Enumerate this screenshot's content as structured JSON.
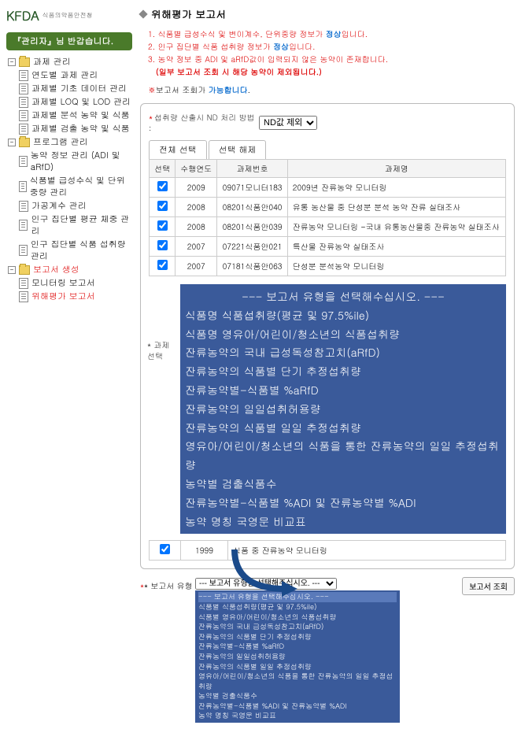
{
  "logo": {
    "main": "KFDA",
    "sub": "식품의약품안전청"
  },
  "welcome": "『관리자』님 반갑습니다.",
  "tree": {
    "group1": "과제 관리",
    "g1_items": [
      "연도별 과제 관리",
      "과제별 기초 데이터 관리",
      "과제별 LOQ 및 LOD 관리",
      "과제별 분석 농약 및 식품",
      "과제별 검출 농약 및 식품"
    ],
    "group2": "프로그램 관리",
    "g2_items": [
      "농약 정보 관리 (ADI 및 aRfD)",
      "식품별 급성수식 및 단위중량 관리",
      "가공계수 관리",
      "인구 집단별 평균 체중 관리",
      "인구 집단별 식품 섭취량 관리"
    ],
    "group3": {
      "label": "보고서 생성",
      "items": [
        "모니터링 보고서",
        "위해평가 보고서"
      ]
    }
  },
  "page_title": "위해평가 보고서",
  "notices": [
    {
      "n": "1.",
      "text": "식품별 급성수식 및 변이계수, 단위중량 정보가 ",
      "bold": "정상",
      "suffix": "입니다."
    },
    {
      "n": "2.",
      "text": "인구 집단별 식품 섭취량 정보가 ",
      "bold": "정상",
      "suffix": "입니다."
    },
    {
      "n": "3.",
      "text": "농약 정보 중 ADI 및 aRfD값이 입력되지 않은 농약이 존재합니다."
    }
  ],
  "warn": "(일부 보고서 조회 시 해당 농약이 제외됩니다.)",
  "tip_prefix": "※",
  "tip_text": "보고서 조회가 ",
  "tip_bold": "가능합니다",
  "tip_suffix": ".",
  "nd_label": "섭취량 산출시 ND 처리 방법 :",
  "nd_value": "ND값 제외",
  "tabs": [
    "전체 선택",
    "선택 해제"
  ],
  "table": {
    "headers": [
      "선택",
      "수행연도",
      "과제번호",
      "과제명"
    ],
    "rows": [
      {
        "y": "2009",
        "no": "09071모니터183",
        "name": "2009년 잔류농약 모니터링"
      },
      {
        "y": "2008",
        "no": "08201식품안040",
        "name": "유통 농산물 중 단성분 분석 농약 잔류 실태조사"
      },
      {
        "y": "2008",
        "no": "08201식품안039",
        "name": "잔류농약 모니터링 -국내 유통농산물중 잔류농약 실태조사"
      },
      {
        "y": "2007",
        "no": "07221식품안021",
        "name": "특산물 잔류농약 실태조사"
      },
      {
        "y": "2007",
        "no": "07181식품안063",
        "name": "단성분 분석농약 모니터링"
      }
    ]
  },
  "assign_label": "* 과제 선택",
  "big_options": [
    "--- 보고서 유형을 선택해수십시오. ---",
    "식품명 식품섭취량(평균 및 97.5%ile)",
    "식품명 영유아/어린이/청소년의 식품섭취량",
    "잔류농약의 국내 급성독성참고치(aRfD)",
    "잔류농약의 식품별 단기 추정섭취량",
    "잔류농약별-식품별 %aRfD",
    "잔류농약의 일일섭취허용량",
    "잔류농약의 식품별 일일 추정섭취량",
    "영유아/어린이/청소년의 식품을 통한 잔류농약의 일일 추정섭취량",
    "농약별 검출식품수",
    "잔류농약별-식품별 %ADI 및 잔류농약별 %ADI",
    "농약 명칭 국영문 비교표"
  ],
  "bottom_row": {
    "year": "1999",
    "name": "식품 중 잔류농약 모니터링"
  },
  "type_label": "* 보고서 유형",
  "type_select_value": "--- 보고서 유형을 선택해주십시오. ---",
  "small_options": [
    "--- 보고서 유형을 선택해수십시오. ---",
    "식품별 식품섭취량(평균 및 97.5%ile)",
    "식품별 영유아/어린이/청소년의 식품섭취량",
    "잔류농약의 국내 급성독성참고치(aRfD)",
    "잔류농약의 식품별 단기 추정섭취량",
    "잔류농약별-식품별 %aRfD",
    "잔류농약의 일일섭취허용량",
    "잔류농약의 식품별 일일 추정섭취량",
    "영유아/어린이/청소년의 식품을 통한 잔류농약의 일일 추정섭취량",
    "농약별 검출식품수",
    "잔류농약별-식품별 %ADI 및 잔류농약별 %ADI",
    "농약 명칭 국영문 비교표"
  ],
  "lookup_btn": "보고서 조회"
}
